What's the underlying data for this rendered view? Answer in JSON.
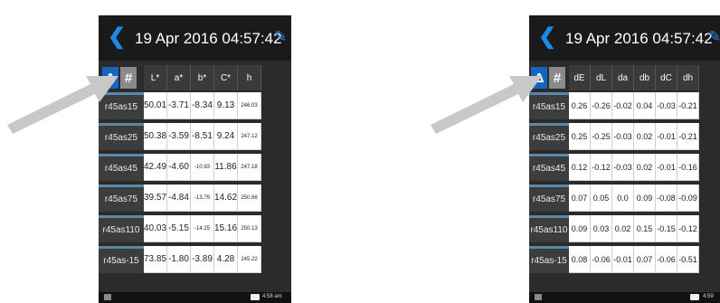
{
  "left": {
    "title": "19 Apr 2016 04:57:42",
    "toggle_delta": "Δ",
    "toggle_hash": "#",
    "columns": [
      "L*",
      "a*",
      "b*",
      "C*",
      "h"
    ],
    "rows": [
      {
        "label": "r45as15",
        "values": [
          "50.01",
          "-3.71",
          "-8.34",
          "9.13",
          "246.03"
        ]
      },
      {
        "label": "r45as25",
        "values": [
          "50.38",
          "-3.59",
          "-8.51",
          "9.24",
          "247.12"
        ]
      },
      {
        "label": "r45as45",
        "values": [
          "42.49",
          "-4.60",
          "-10.93",
          "11.86",
          "247.18"
        ]
      },
      {
        "label": "r45as75",
        "values": [
          "39.57",
          "-4.84",
          "-13.79",
          "14.62",
          "250.66"
        ]
      },
      {
        "label": "r45as110",
        "values": [
          "40.03",
          "-5.15",
          "-14.25",
          "15.16",
          "250.13"
        ]
      },
      {
        "label": "r45as-15",
        "values": [
          "73.85",
          "-1.80",
          "-3.89",
          "4.28",
          "245.22"
        ]
      }
    ],
    "status_time": "4:58 am"
  },
  "right": {
    "title": "19 Apr 2016 04:57:42",
    "toggle_delta": "Δ",
    "toggle_hash": "#",
    "columns": [
      "dE",
      "dL",
      "da",
      "db",
      "dC",
      "dh"
    ],
    "rows": [
      {
        "label": "r45as15",
        "values": [
          "0.26",
          "-0.26",
          "-0.02",
          "0.04",
          "-0.03",
          "-0.21"
        ]
      },
      {
        "label": "r45as25",
        "values": [
          "0.25",
          "-0.25",
          "-0.03",
          "0.02",
          "-0.01",
          "-0.21"
        ]
      },
      {
        "label": "r45as45",
        "values": [
          "0.12",
          "-0.12",
          "-0.03",
          "0.02",
          "-0.01",
          "-0.16"
        ]
      },
      {
        "label": "r45as75",
        "values": [
          "0.07",
          "0.05",
          "0.0",
          "0.09",
          "-0.08",
          "-0.09"
        ]
      },
      {
        "label": "r45as110",
        "values": [
          "0.09",
          "0.03",
          "0.02",
          "0.15",
          "-0.15",
          "-0.12"
        ]
      },
      {
        "label": "r45as-15",
        "values": [
          "0.08",
          "-0.06",
          "-0.01",
          "0.07",
          "-0.06",
          "-0.51"
        ]
      }
    ],
    "status_time": "4:59"
  },
  "colors": {
    "accent": "#1e88e5",
    "delta_toggle": "#1565c0",
    "arrow": "#c8c8c8"
  },
  "icons": [
    "back-chevron-icon",
    "pencil-icon",
    "battery-icon",
    "arrow-pointer-icon"
  ]
}
